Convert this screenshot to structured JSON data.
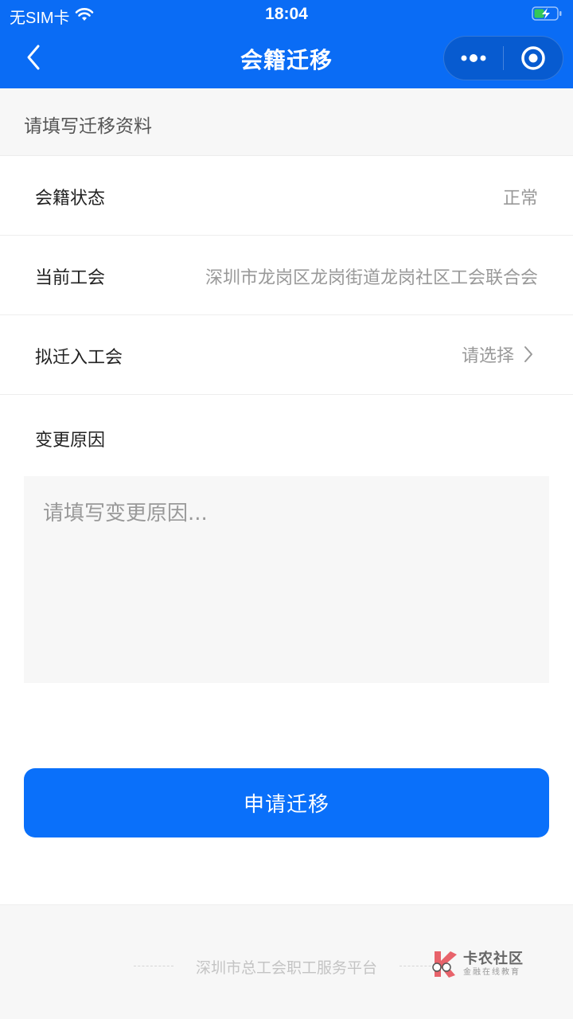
{
  "status_bar": {
    "carrier": "无SIM卡",
    "time": "18:04",
    "wifi_icon": "wifi-icon",
    "battery_icon": "battery-charging-icon"
  },
  "nav": {
    "title": "会籍迁移",
    "back_icon": "chevron-left-icon",
    "more_icon": "more-dots-icon",
    "close_icon": "target-circle-icon"
  },
  "form": {
    "section_title": "请填写迁移资料",
    "rows": [
      {
        "label": "会籍状态",
        "value": "正常"
      },
      {
        "label": "当前工会",
        "value": "深圳市龙岗区龙岗街道龙岗社区工会联合会"
      },
      {
        "label": "拟迁入工会",
        "value": "请选择"
      }
    ],
    "reason_label": "变更原因",
    "reason_value": "",
    "reason_placeholder": "请填写变更原因..."
  },
  "submit_label": "申请迁移",
  "footer": {
    "text": "深圳市总工会职工服务平台",
    "watermark_title": "卡农社区",
    "watermark_subtitle": "金融在线教育"
  },
  "colors": {
    "primary": "#0a6cf5",
    "button": "#0a70fa",
    "muted_text": "#999999",
    "section_bg": "#f7f7f7"
  }
}
